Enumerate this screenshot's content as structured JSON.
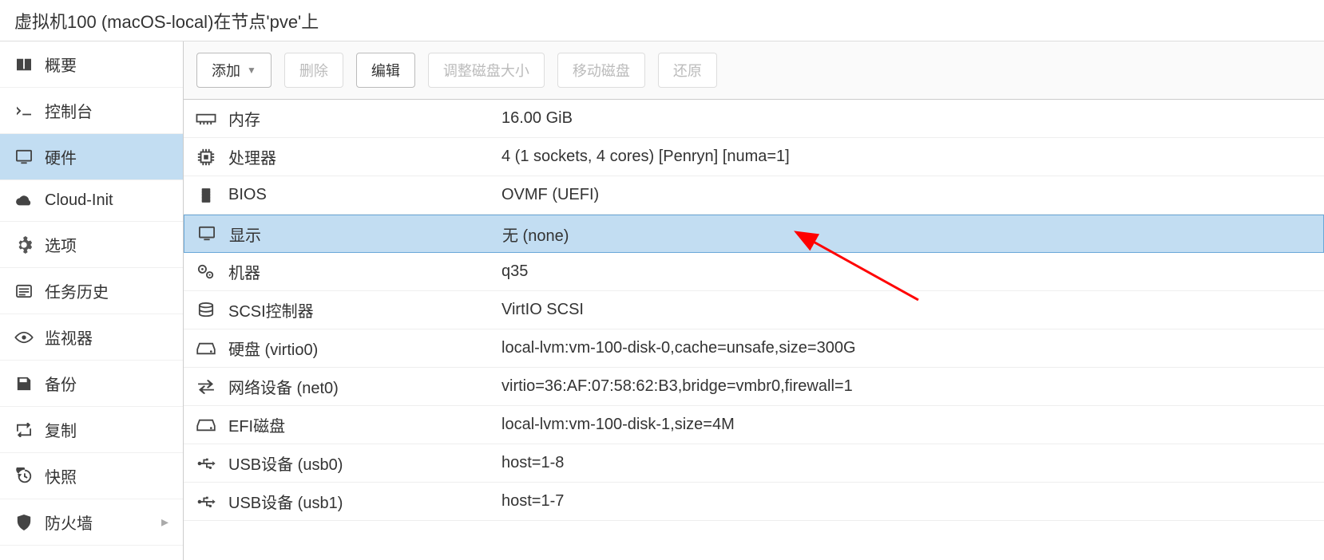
{
  "header": {
    "title": "虚拟机100 (macOS-local)在节点'pve'上"
  },
  "sidebar": {
    "items": [
      {
        "label": "概要",
        "icon": "book"
      },
      {
        "label": "控制台",
        "icon": "terminal"
      },
      {
        "label": "硬件",
        "icon": "monitor",
        "active": true
      },
      {
        "label": "Cloud-Init",
        "icon": "cloud"
      },
      {
        "label": "选项",
        "icon": "gear"
      },
      {
        "label": "任务历史",
        "icon": "list"
      },
      {
        "label": "监视器",
        "icon": "eye"
      },
      {
        "label": "备份",
        "icon": "floppy"
      },
      {
        "label": "复制",
        "icon": "retweet"
      },
      {
        "label": "快照",
        "icon": "history"
      },
      {
        "label": "防火墙",
        "icon": "shield",
        "chevron": true
      }
    ]
  },
  "toolbar": {
    "add": "添加",
    "remove": "删除",
    "edit": "编辑",
    "resize": "调整磁盘大小",
    "move": "移动磁盘",
    "revert": "还原"
  },
  "hardware": {
    "rows": [
      {
        "icon": "memory",
        "key": "内存",
        "val": "16.00 GiB"
      },
      {
        "icon": "cpu",
        "key": "处理器",
        "val": "4 (1 sockets, 4 cores) [Penryn] [numa=1]"
      },
      {
        "icon": "chip",
        "key": "BIOS",
        "val": "OVMF (UEFI)"
      },
      {
        "icon": "monitor",
        "key": "显示",
        "val": "无 (none)",
        "selected": true
      },
      {
        "icon": "cogs",
        "key": "机器",
        "val": "q35"
      },
      {
        "icon": "db",
        "key": "SCSI控制器",
        "val": "VirtIO SCSI"
      },
      {
        "icon": "hdd",
        "key": "硬盘 (virtio0)",
        "val": "local-lvm:vm-100-disk-0,cache=unsafe,size=300G"
      },
      {
        "icon": "net",
        "key": "网络设备 (net0)",
        "val": "virtio=36:AF:07:58:62:B3,bridge=vmbr0,firewall=1"
      },
      {
        "icon": "hdd",
        "key": "EFI磁盘",
        "val": "local-lvm:vm-100-disk-1,size=4M"
      },
      {
        "icon": "usb",
        "key": "USB设备 (usb0)",
        "val": "host=1-8"
      },
      {
        "icon": "usb",
        "key": "USB设备 (usb1)",
        "val": "host=1-7"
      }
    ]
  }
}
